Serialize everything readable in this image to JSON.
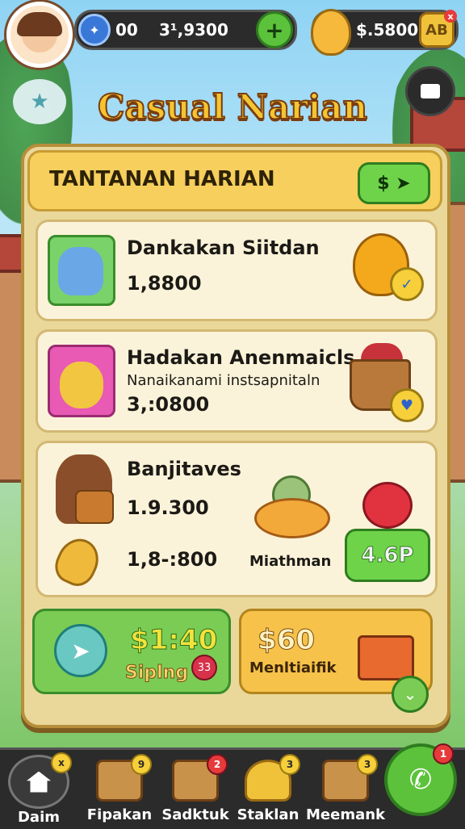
{
  "hud": {
    "gems_value": "00",
    "coins_value": "3¹,9300",
    "cash_value": "$.5800",
    "plus_label": "+",
    "bag_label": "AB",
    "bag_x": "x"
  },
  "title": "Casual Narian",
  "panel": {
    "header_title": "TANTANAN HARIAN",
    "header_button": "$ ➤",
    "cards": [
      {
        "name": "Dankakan Siitdan",
        "value": "1,8800"
      },
      {
        "name": "Hadakan Anenmaicls",
        "sub": "Nanaikanami instsapnitaln",
        "value": "3,:0800"
      },
      {
        "name": "Banjitaves",
        "value1": "1.9.300",
        "value2": "1,8-:800",
        "item_label": "Miathman",
        "price": "4.6P"
      }
    ],
    "bottom_left": {
      "amount": "$1:40",
      "label": "Siplng",
      "badge": "33"
    },
    "bottom_right": {
      "amount": "$60",
      "label": "Menltiaifik"
    }
  },
  "nav": {
    "items": [
      {
        "label": "Daim",
        "badge": "x"
      },
      {
        "label": "Fipakan",
        "badge": "9"
      },
      {
        "label": "Sadktuk",
        "badge": "2"
      },
      {
        "label": "Staklan",
        "badge": "3"
      },
      {
        "label": "Meemank",
        "badge": "3"
      }
    ],
    "fab_badge": "1"
  }
}
